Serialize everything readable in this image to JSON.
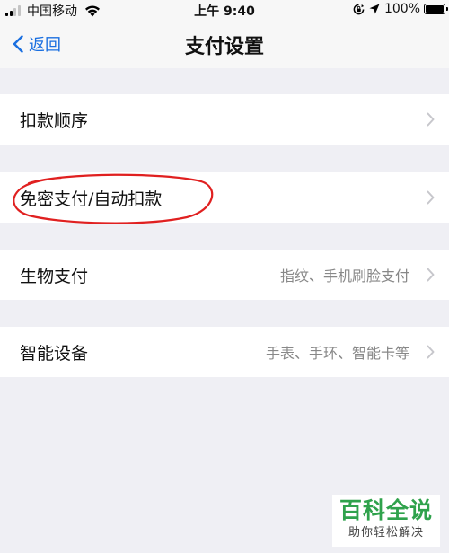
{
  "status_bar": {
    "carrier": "中国移动",
    "time": "上午 9:40",
    "battery": "100%",
    "battery_level": 1.0
  },
  "nav": {
    "back_label": "返回",
    "title": "支付设置"
  },
  "rows": [
    {
      "label": "扣款顺序",
      "value": ""
    },
    {
      "label": "免密支付/自动扣款",
      "value": ""
    },
    {
      "label": "生物支付",
      "value": "指纹、手机刷脸支付"
    },
    {
      "label": "智能设备",
      "value": "手表、手环、智能卡等"
    }
  ],
  "annotation_color": "#e02020",
  "accent_color": "#1a6fe0",
  "watermark": {
    "main": "百科全说",
    "sub": "助你轻松解决"
  }
}
